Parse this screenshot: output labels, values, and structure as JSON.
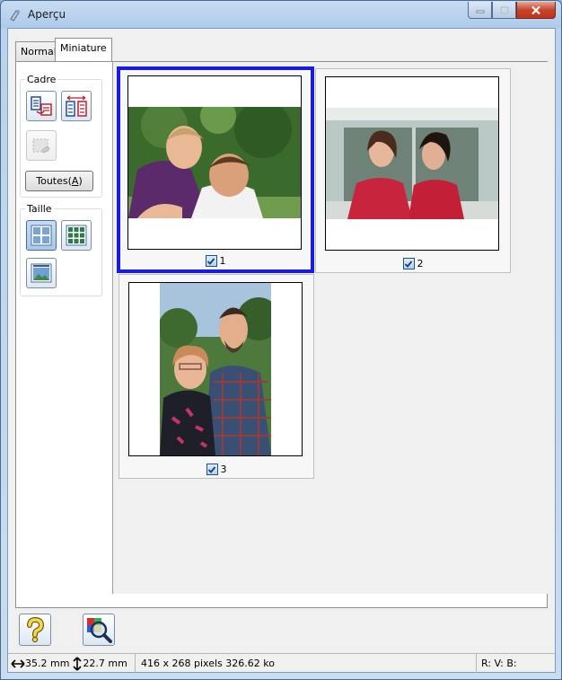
{
  "window": {
    "title": "Aperçu"
  },
  "tabs": [
    {
      "label": "Normal",
      "active": false
    },
    {
      "label": "Miniature",
      "active": true
    }
  ],
  "sidebar": {
    "frame_group": {
      "label": "Cadre",
      "all_button_label": "Toutes(A)"
    },
    "size_group": {
      "label": "Taille"
    }
  },
  "thumbnails": [
    {
      "number": "1",
      "checked": true,
      "selected": true
    },
    {
      "number": "2",
      "checked": true,
      "selected": false
    },
    {
      "number": "3",
      "checked": true,
      "selected": false
    }
  ],
  "status": {
    "width": "35.2 mm",
    "height": "22.7 mm",
    "info": "416 x 268 pixels 326.62 ko",
    "rgb": "R: V: B:"
  },
  "colors": {
    "selection_border": "#1a1ae0",
    "window_frame": "#aecbea"
  }
}
